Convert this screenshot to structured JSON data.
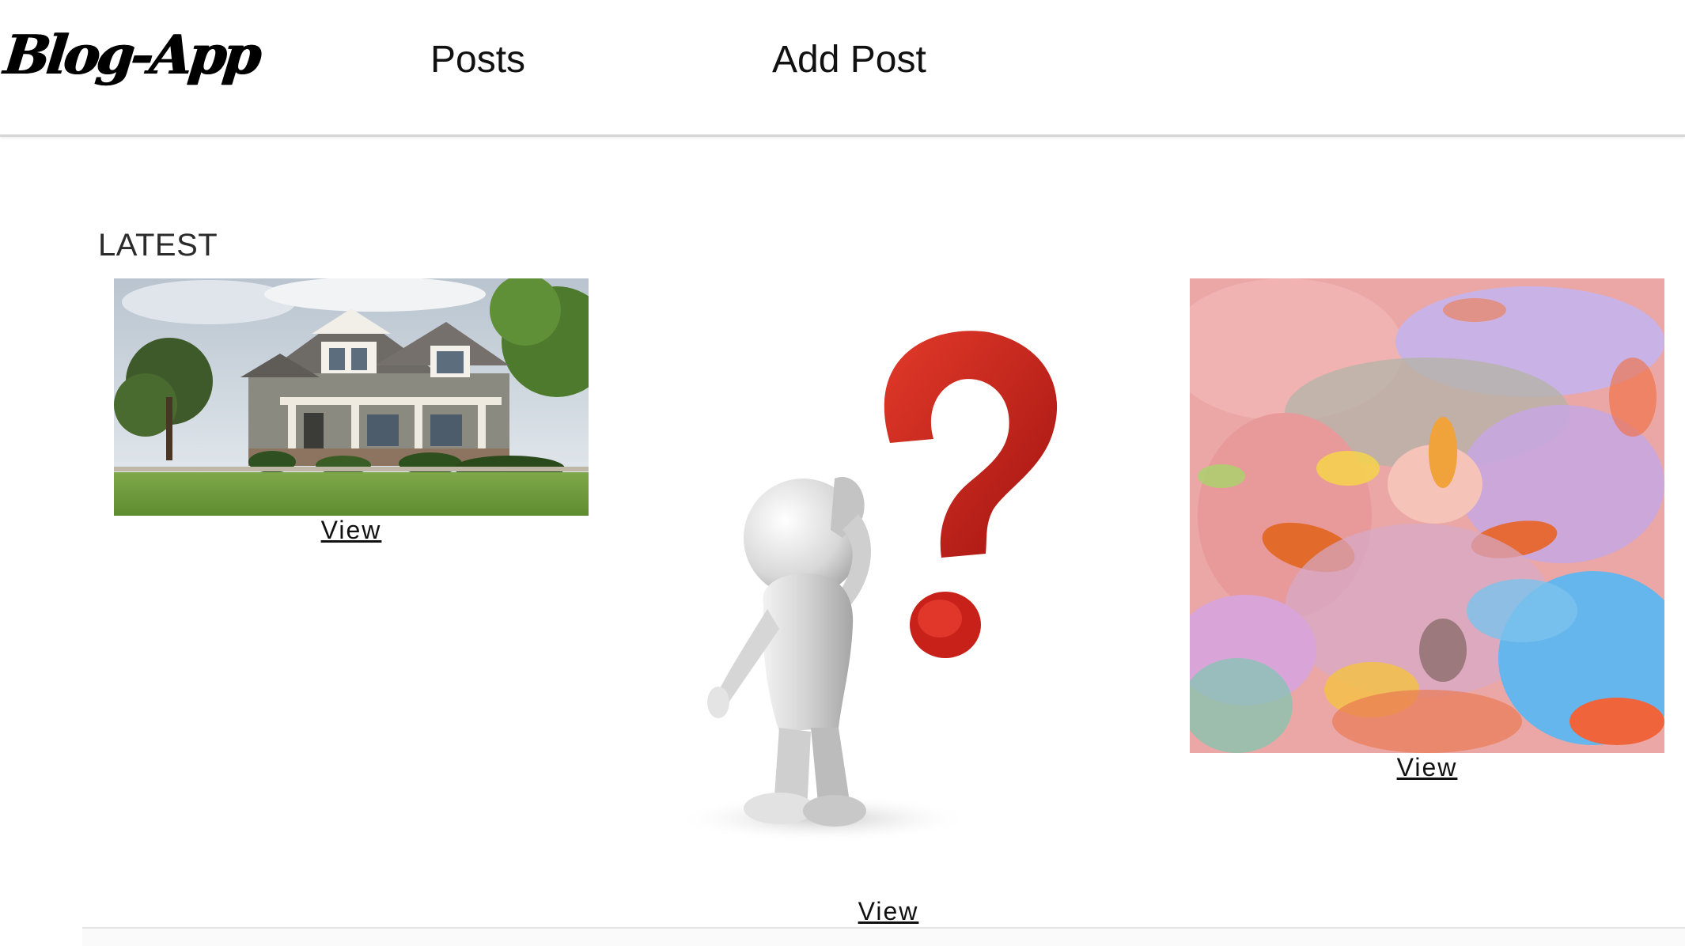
{
  "navbar": {
    "brand": "Blog-App",
    "links": [
      {
        "label": "Posts"
      },
      {
        "label": "Add Post"
      }
    ]
  },
  "main": {
    "section_title": "LATEST",
    "posts": [
      {
        "image": "house-photo",
        "view_label": "View"
      },
      {
        "image": "question-mark-figure",
        "view_label": "View"
      },
      {
        "image": "abstract-painting",
        "view_label": "View"
      }
    ]
  }
}
